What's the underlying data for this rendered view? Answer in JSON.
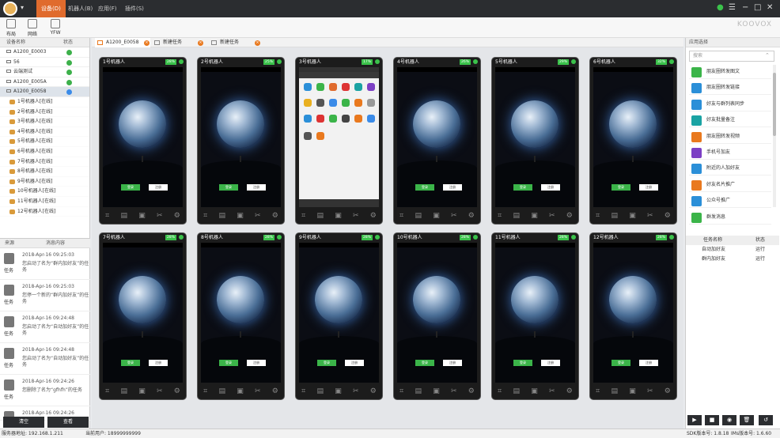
{
  "menu": {
    "items": [
      "设备(D)",
      "机器人(B)",
      "应用(F)",
      "插件(S)"
    ]
  },
  "toolbar": {
    "items": [
      "布局",
      "网络",
      "YFW"
    ],
    "brand": "KOOVOX"
  },
  "tabs": [
    {
      "label": "A1200_E0058"
    },
    {
      "label": "新建任务"
    },
    {
      "label": "新建任务"
    }
  ],
  "devices": {
    "header_name": "设备名称",
    "header_status": "状态",
    "items": [
      {
        "name": "A1200_E0003"
      },
      {
        "name": "56"
      },
      {
        "name": "云端测试"
      },
      {
        "name": "A1200_E005A"
      },
      {
        "name": "A1200_E0058"
      }
    ]
  },
  "robots": [
    "1号机器人[在线]",
    "2号机器人[在线]",
    "3号机器人[在线]",
    "4号机器人[在线]",
    "5号机器人[在线]",
    "6号机器人[在线]",
    "7号机器人[在线]",
    "8号机器人[在线]",
    "9号机器人[在线]",
    "10号机器人[在线]",
    "11号机器人[在线]",
    "12号机器人[在线]"
  ],
  "messages": {
    "header_src": "来源",
    "header_content": "消息内容",
    "items": [
      {
        "label": "任务",
        "time": "2018-Apr-16 09:25:03",
        "text": "您启动了名为“群内加好友”的任务"
      },
      {
        "label": "任务",
        "time": "2018-Apr-16 09:25:03",
        "text": "您停一个新的“群内加好友”的任务"
      },
      {
        "label": "任务",
        "time": "2018-Apr-16 09:24:48",
        "text": "您启动了名为“自动加好友”的任务"
      },
      {
        "label": "任务",
        "time": "2018-Apr-16 09:24:48",
        "text": "您启动了名为“自动加好友”的任务"
      },
      {
        "label": "任务",
        "time": "2018-Apr-16 09:24:26",
        "text": "您删除了名为“gfhfh”的任务"
      },
      {
        "label": "任务",
        "time": "2018-Apr-16 09:24:26",
        "text": ""
      }
    ],
    "clear_label": "清空",
    "view_label": "查看"
  },
  "phones": [
    {
      "name": "1号机器人",
      "battery": "28%"
    },
    {
      "name": "2号机器人",
      "battery": "25%"
    },
    {
      "name": "3号机器人",
      "battery": "17%"
    },
    {
      "name": "4号机器人",
      "battery": "26%"
    },
    {
      "name": "5号机器人",
      "battery": "29%"
    },
    {
      "name": "6号机器人",
      "battery": "32%"
    },
    {
      "name": "7号机器人",
      "battery": "28%"
    },
    {
      "name": "8号机器人",
      "battery": "28%"
    },
    {
      "name": "9号机器人",
      "battery": "28%"
    },
    {
      "name": "10号机器人",
      "battery": "28%"
    },
    {
      "name": "11号机器人",
      "battery": "28%"
    },
    {
      "name": "12号机器人",
      "battery": "28%"
    }
  ],
  "phone_buttons": {
    "login": "登录",
    "register": "注册"
  },
  "apps": {
    "title": "应用选择",
    "search_placeholder": "搜索",
    "items": [
      {
        "label": "朋友圈转发图文",
        "color": "#3bb449"
      },
      {
        "label": "朋友圈转发链接",
        "color": "#2b8fd8"
      },
      {
        "label": "好友与群列表同步",
        "color": "#2b8fd8"
      },
      {
        "label": "好友批量备注",
        "color": "#1aa3a3"
      },
      {
        "label": "朋友圈转发视频",
        "color": "#e9791e"
      },
      {
        "label": "手机号加友",
        "color": "#7c3fc4"
      },
      {
        "label": "附近的人加好友",
        "color": "#2b8fd8"
      },
      {
        "label": "好友名片推广",
        "color": "#e9791e"
      },
      {
        "label": "公众号推广",
        "color": "#2b8fd8"
      },
      {
        "label": "群发消息",
        "color": "#3bb449"
      }
    ]
  },
  "tasks": {
    "header_name": "任务名称",
    "header_status": "状态",
    "items": [
      {
        "name": "自动加好友",
        "status": "运行"
      },
      {
        "name": "群内加好友",
        "status": "运行"
      }
    ]
  },
  "status": {
    "server": "服务器地址: 192.168.1.211",
    "user": "当前用户: 18999999999",
    "sdk": "SDK版本号: 1.8.18",
    "ios": "IMs版本号: 1.6.60"
  }
}
